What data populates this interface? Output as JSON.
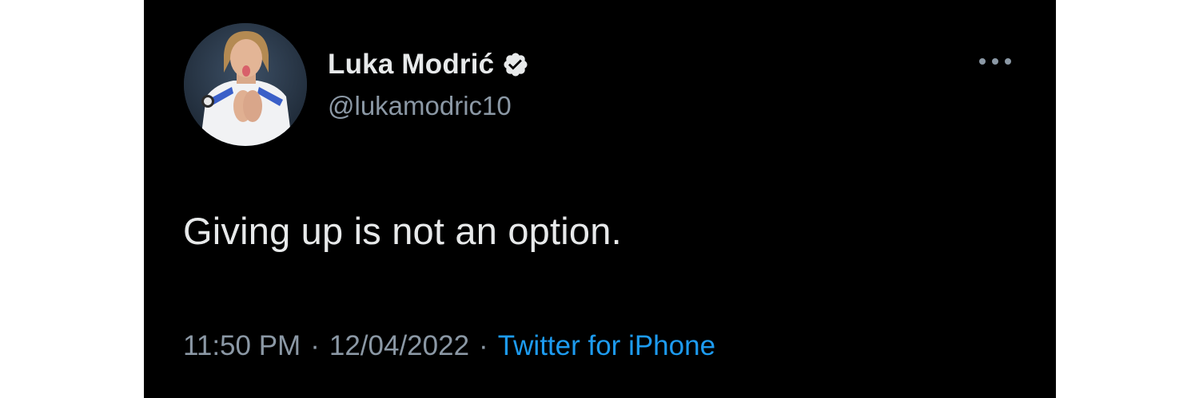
{
  "tweet": {
    "author": {
      "display_name": "Luka Modrić",
      "handle": "@lukamodric10",
      "verified": true,
      "avatar_icon": "profile-photo"
    },
    "text": "Giving up is not an option.",
    "time": "11:50 PM",
    "date": "12/04/2022",
    "separator": "·",
    "source": "Twitter for iPhone",
    "more_icon": "more-horizontal-icon"
  },
  "theme": {
    "background": "#000000",
    "text_primary": "#e7e9ea",
    "text_secondary": "#8b98a5",
    "link": "#1d9bf0"
  }
}
